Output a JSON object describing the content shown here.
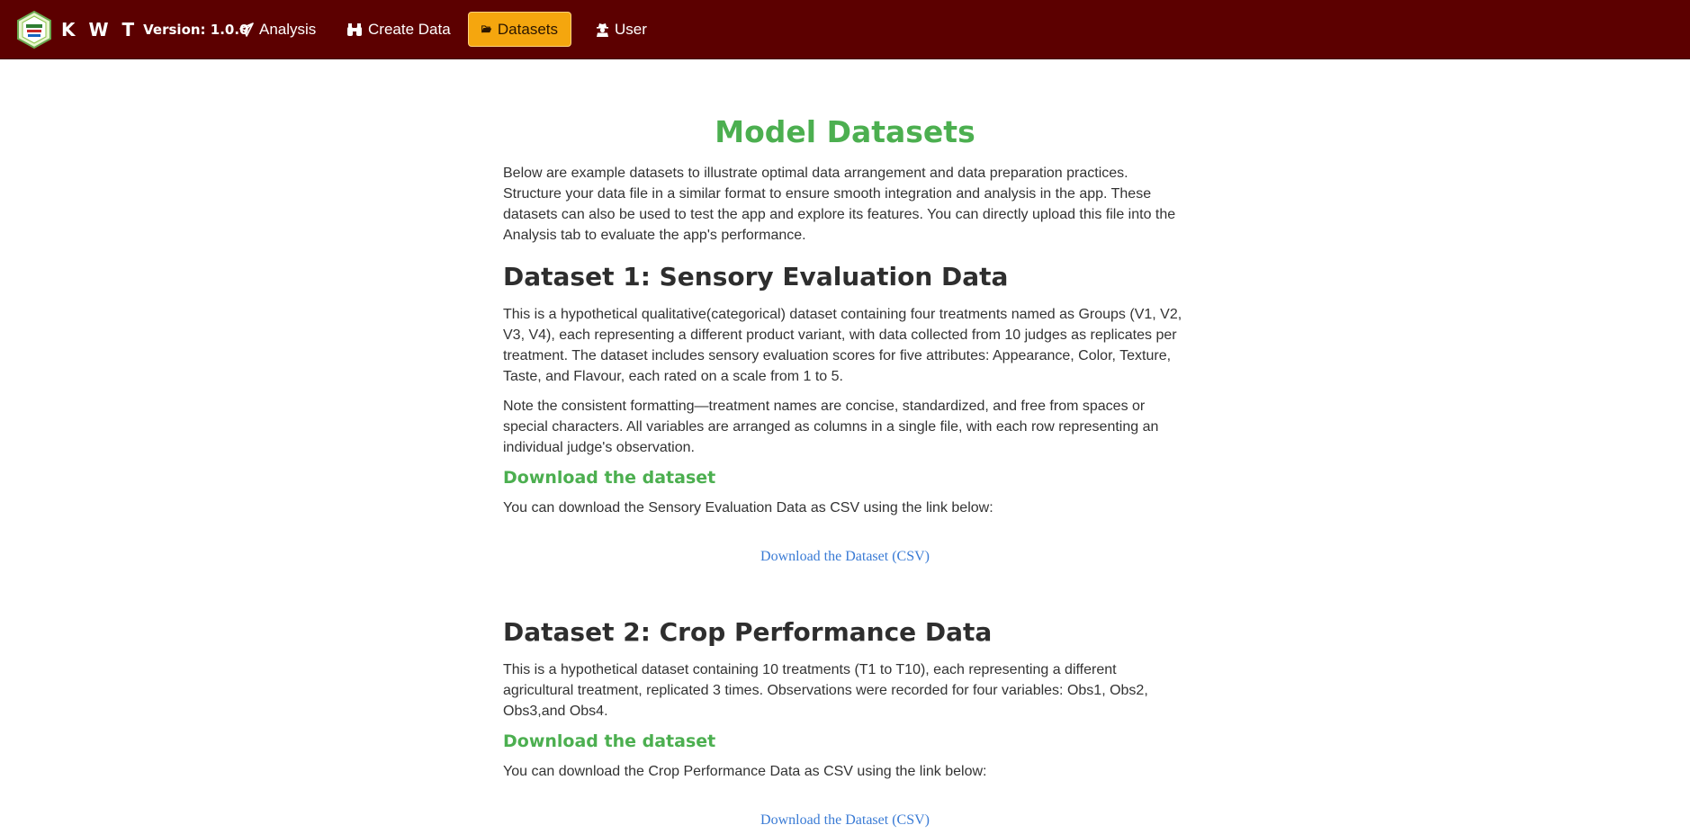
{
  "navbar": {
    "brand": "K W T",
    "version": "Version: 1.0.0",
    "items": [
      {
        "label": "Analysis",
        "icon": "paper-plane-icon"
      },
      {
        "label": "Create Data",
        "icon": "binoculars-icon"
      },
      {
        "label": "Datasets",
        "icon": "folder-open-icon",
        "active": true
      },
      {
        "label": "User",
        "icon": "user-secret-icon"
      }
    ]
  },
  "main": {
    "title": "Model Datasets",
    "intro": "Below are example datasets to illustrate optimal data arrangement and data preparation practices. Structure your data file in a similar format to ensure smooth integration and analysis in the app. These datasets can also be used to test the app and explore its features. You can directly upload this file into the Analysis tab to evaluate the app's performance.",
    "datasets": [
      {
        "heading": "Dataset 1: Sensory Evaluation Data",
        "description": "This is a hypothetical qualitative(categorical) dataset containing four treatments named as Groups (V1, V2, V3, V4), each representing a different product variant, with data collected from 10 judges as replicates per treatment. The dataset includes sensory evaluation scores for five attributes: Appearance, Color, Texture, Taste, and Flavour, each rated on a scale from 1 to 5.",
        "note": "Note the consistent formatting—treatment names are concise, standardized, and free from spaces or special characters. All variables are arranged as columns in a single file, with each row representing an individual judge's observation.",
        "download_heading": "Download the dataset",
        "download_text": "You can download the Sensory Evaluation Data as CSV using the link below:",
        "link_label": "Download the Dataset (CSV)"
      },
      {
        "heading": "Dataset 2: Crop Performance Data",
        "description": "This is a hypothetical dataset containing 10 treatments (T1 to T10), each representing a different agricultural treatment, replicated 3 times. Observations were recorded for four variables: Obs1, Obs2, Obs3,and Obs4.",
        "download_heading": "Download the dataset",
        "download_text": "You can download the Crop Performance Data as CSV using the link below:",
        "link_label": "Download the Dataset (CSV)"
      }
    ]
  },
  "colors": {
    "navbar_bg": "#5c0000",
    "active_tab": "#f5a60e",
    "accent_green": "#4caf50",
    "link_blue": "#3a7bd5"
  }
}
